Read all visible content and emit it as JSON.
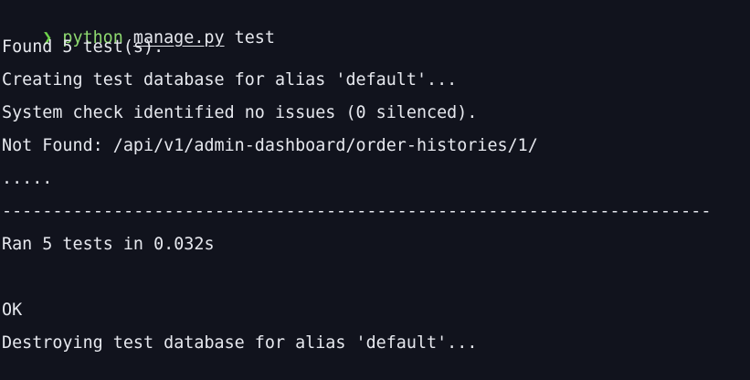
{
  "prompt": {
    "symbol": "❯",
    "command": "python",
    "script": "manage.py",
    "argument": "test"
  },
  "output": [
    "Found 5 test(s).",
    "Creating test database for alias 'default'...",
    "System check identified no issues (0 silenced).",
    "Not Found: /api/v1/admin-dashboard/order-histories/1/",
    ".....",
    "----------------------------------------------------------------------",
    "Ran 5 tests in 0.032s",
    "",
    "OK",
    "Destroying test database for alias 'default'..."
  ],
  "colors": {
    "background": "#11131d",
    "text": "#e6e8ee",
    "prompt": "#6dd14a"
  }
}
